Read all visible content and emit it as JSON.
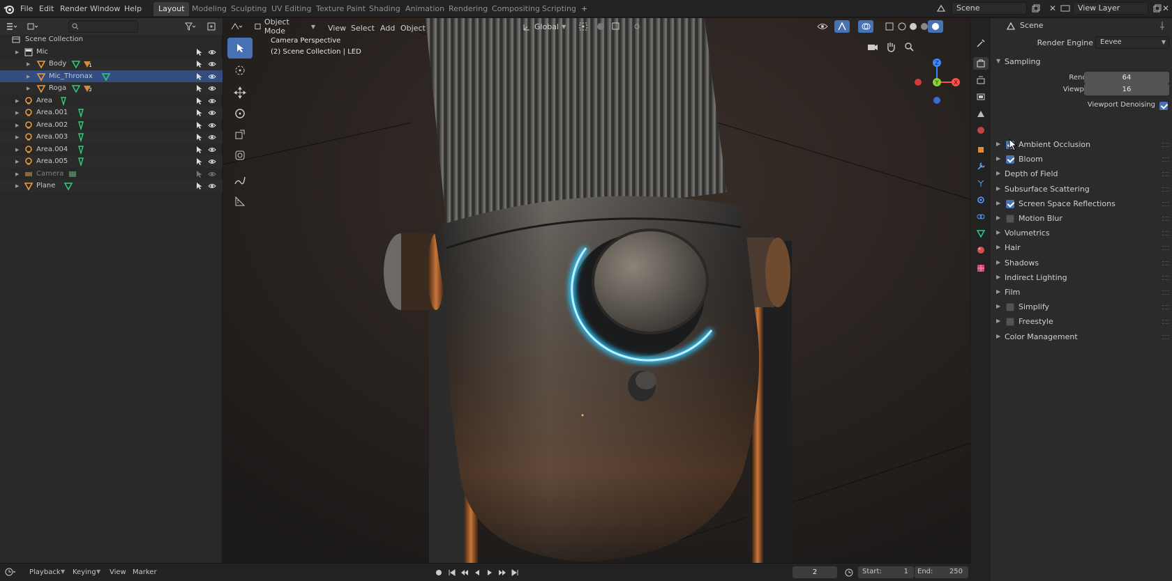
{
  "menu": {
    "file": "File",
    "edit": "Edit",
    "render": "Render",
    "window": "Window",
    "help": "Help"
  },
  "workspaces": [
    "Layout",
    "Modeling",
    "Sculpting",
    "UV Editing",
    "Texture Paint",
    "Shading",
    "Animation",
    "Rendering",
    "Compositing",
    "Scripting"
  ],
  "active_workspace": "Layout",
  "scene_field": "Scene",
  "view_layer_field": "View Layer",
  "outliner": {
    "search_placeholder": "",
    "root": "Scene Collection",
    "rows": [
      {
        "name": "Mic",
        "kind": "collection"
      },
      {
        "name": "Body",
        "kind": "mesh",
        "badge": "1"
      },
      {
        "name": "Mic_Thronax",
        "kind": "mesh",
        "selected": true
      },
      {
        "name": "Roga",
        "kind": "mesh",
        "badge": "2"
      },
      {
        "name": "Area",
        "kind": "light"
      },
      {
        "name": "Area.001",
        "kind": "light"
      },
      {
        "name": "Area.002",
        "kind": "light"
      },
      {
        "name": "Area.003",
        "kind": "light"
      },
      {
        "name": "Area.004",
        "kind": "light"
      },
      {
        "name": "Area.005",
        "kind": "light"
      },
      {
        "name": "Camera",
        "kind": "camera",
        "dimmed": true
      },
      {
        "name": "Plane",
        "kind": "mesh"
      }
    ]
  },
  "viewport": {
    "mode": "Object Mode",
    "menu": [
      "View",
      "Select",
      "Add",
      "Object"
    ],
    "orientation": "Global",
    "overlay_line1": "Camera Perspective",
    "overlay_line2": "(2) Scene Collection | LED",
    "gizmo": {
      "x": "X",
      "y": "Y",
      "z": "Z"
    }
  },
  "properties": {
    "header": "Scene",
    "render_engine_label": "Render Engine",
    "render_engine_value": "Eevee",
    "sampling": "Sampling",
    "render_label": "Render",
    "render_value": "64",
    "viewport_label": "Viewport",
    "viewport_value": "16",
    "viewport_denoising": "Viewport Denoising",
    "sections": [
      {
        "label": "Ambient Occlusion",
        "check": true
      },
      {
        "label": "Bloom",
        "check": true
      },
      {
        "label": "Depth of Field"
      },
      {
        "label": "Subsurface Scattering"
      },
      {
        "label": "Screen Space Reflections",
        "check": true
      },
      {
        "label": "Motion Blur",
        "check": false
      },
      {
        "label": "Volumetrics"
      },
      {
        "label": "Hair"
      },
      {
        "label": "Shadows"
      },
      {
        "label": "Indirect Lighting"
      },
      {
        "label": "Film"
      },
      {
        "label": "Simplify",
        "check": false
      },
      {
        "label": "Freestyle",
        "check": false
      },
      {
        "label": "Color Management"
      }
    ]
  },
  "timeline": {
    "playback": "Playback",
    "keying": "Keying",
    "view": "View",
    "marker": "Marker",
    "current_frame": "2",
    "start_label": "Start:",
    "start": "1",
    "end_label": "End:",
    "end": "250"
  },
  "colors": {
    "accent": "#4772b3",
    "selection": "#334d80",
    "led": "#2fc7ff"
  }
}
